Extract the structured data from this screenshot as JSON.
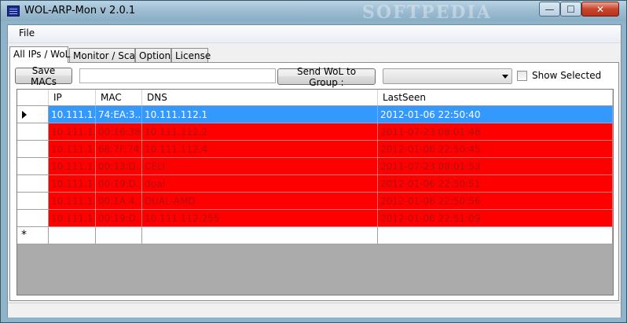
{
  "window": {
    "title": "WOL-ARP-Mon v 2.0.1",
    "watermark": "SOFTPEDIA",
    "min_glyph": "—",
    "max_glyph": "☐",
    "close_glyph": "✕"
  },
  "menu": {
    "file": "File"
  },
  "tabs": [
    {
      "label": "All IPs / WoL",
      "active": true
    },
    {
      "label": "Monitor / Scan"
    },
    {
      "label": "Options"
    },
    {
      "label": "License"
    }
  ],
  "toolbar": {
    "save_label": "Save MACs",
    "filter_value": "",
    "wol_label": "Send WoL to Group :",
    "group_value": "",
    "show_selected_label": "Show Selected",
    "show_selected_checked": false
  },
  "grid": {
    "columns": [
      "IP",
      "MAC",
      "DNS",
      "LastSeen"
    ],
    "rows": [
      {
        "ip": "10.111.1...",
        "mac": "74:EA:3...",
        "dns": "10.111.112.1",
        "lastseen": "2012-01-06 22:50:40",
        "state": "selected"
      },
      {
        "ip": "10.111.1...",
        "mac": "00:16:38...",
        "dns": "10.111.112.2",
        "lastseen": "2011-07-23 08:01:48",
        "state": "red"
      },
      {
        "ip": "10.111.1...",
        "mac": "68:7F:74...",
        "dns": "10.111.112.4",
        "lastseen": "2012-01-06 22:50:45",
        "state": "red"
      },
      {
        "ip": "10.111.1...",
        "mac": "00:13:D...",
        "dns": "CELI",
        "lastseen": "2011-07-23 08:01:53",
        "state": "red"
      },
      {
        "ip": "10.111.1...",
        "mac": "00:19:D...",
        "dns": "dual",
        "lastseen": "2012-01-06 22:50:51",
        "state": "red"
      },
      {
        "ip": "10.111.1...",
        "mac": "00:1A:4...",
        "dns": "DUAL-AMD",
        "lastseen": "2012-01-06 22:50:56",
        "state": "red"
      },
      {
        "ip": "10.111.1...",
        "mac": "00:19:D...",
        "dns": "10.111.112.255",
        "lastseen": "2012-01-06 22:51:09",
        "state": "red"
      }
    ],
    "new_row_marker": "*"
  },
  "colors": {
    "row_red": "#ff0000",
    "row_selected": "#3399ff",
    "grid_background": "#ababab"
  }
}
